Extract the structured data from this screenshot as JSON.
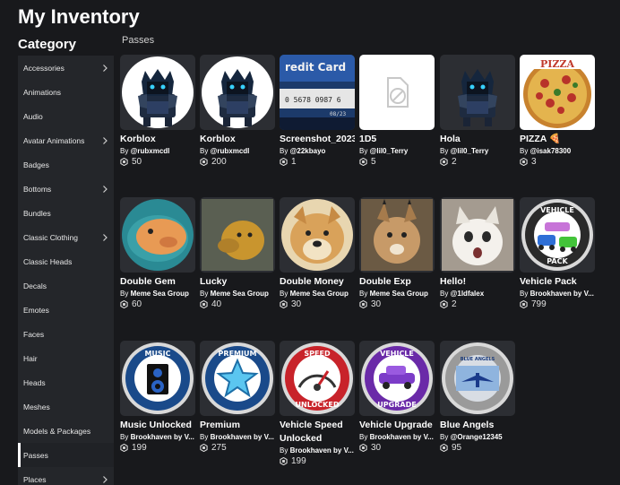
{
  "page": {
    "title": "My Inventory"
  },
  "sidebar": {
    "title": "Category",
    "items": [
      {
        "label": "Accessories",
        "chevron": true
      },
      {
        "label": "Animations",
        "chevron": false
      },
      {
        "label": "Audio",
        "chevron": false
      },
      {
        "label": "Avatar Animations",
        "chevron": true
      },
      {
        "label": "Badges",
        "chevron": false
      },
      {
        "label": "Bottoms",
        "chevron": true
      },
      {
        "label": "Bundles",
        "chevron": false
      },
      {
        "label": "Classic Clothing",
        "chevron": true
      },
      {
        "label": "Classic Heads",
        "chevron": false
      },
      {
        "label": "Decals",
        "chevron": false
      },
      {
        "label": "Emotes",
        "chevron": false
      },
      {
        "label": "Faces",
        "chevron": false
      },
      {
        "label": "Hair",
        "chevron": false
      },
      {
        "label": "Heads",
        "chevron": false
      },
      {
        "label": "Meshes",
        "chevron": false
      },
      {
        "label": "Models & Packages",
        "chevron": false
      },
      {
        "label": "Passes",
        "chevron": false,
        "active": true
      },
      {
        "label": "Places",
        "chevron": true
      }
    ]
  },
  "main": {
    "section_title": "Passes",
    "items": [
      {
        "name": "Korblox",
        "by": "By",
        "creator": "@rubxmcdl",
        "count": "50",
        "icon": "korblox-avatar-icon"
      },
      {
        "name": "Korblox",
        "by": "By",
        "creator": "@rubxmcdl",
        "count": "200",
        "icon": "korblox-avatar-icon"
      },
      {
        "name": "Screenshot_2023",
        "by": "By",
        "creator": "@22kbayo",
        "count": "1",
        "icon": "credit-card-photo",
        "thumb_text": "redit Card",
        "thumb_digits": "0 5678 0987 6",
        "thumb_date": "08/23"
      },
      {
        "name": "1D5",
        "by": "By",
        "creator": "@lil0_Terry",
        "count": "5",
        "icon": "broken-image-icon"
      },
      {
        "name": "Hola",
        "by": "By",
        "creator": "@lil0_Terry",
        "count": "2",
        "icon": "korblox-avatar-icon"
      },
      {
        "name": "PIZZA 🍕",
        "by": "By",
        "creator": "@isak78300",
        "count": "3",
        "icon": "pizza-photo"
      },
      {
        "name": "Double Gem",
        "by": "By",
        "creator": "Meme Sea Group",
        "count": "60",
        "icon": "fish-photo"
      },
      {
        "name": "Lucky",
        "by": "By",
        "creator": "Meme Sea Group",
        "count": "40",
        "icon": "cheems-dog-photo"
      },
      {
        "name": "Double Money",
        "by": "By",
        "creator": "Meme Sea Group",
        "count": "30",
        "icon": "doge-photo"
      },
      {
        "name": "Double Exp",
        "by": "By",
        "creator": "Meme Sea Group",
        "count": "30",
        "icon": "floppa-photo"
      },
      {
        "name": "Hello!",
        "by": "By",
        "creator": "@1ldfalex",
        "count": "2",
        "icon": "cat-photo"
      },
      {
        "name": "Vehicle Pack",
        "by": "By",
        "creator": "Brookhaven by V...",
        "count": "799",
        "icon": "vehicle-pack-badge",
        "badge_top": "VEHICLE",
        "badge_bottom": "PACK"
      },
      {
        "name": "Music Unlocked",
        "by": "By",
        "creator": "Brookhaven by V...",
        "count": "199",
        "icon": "music-badge",
        "badge_top": "MUSIC"
      },
      {
        "name": "Premium",
        "by": "By",
        "creator": "Brookhaven by V...",
        "count": "275",
        "icon": "premium-badge",
        "badge_top": "PREMIUM"
      },
      {
        "name": "Vehicle Speed Unlocked",
        "by": "By",
        "creator": "Brookhaven by V...",
        "count": "199",
        "icon": "speed-badge",
        "badge_top": "SPEED",
        "badge_bottom": "UNLOCKED"
      },
      {
        "name": "Vehicle Upgrade",
        "by": "By",
        "creator": "Brookhaven by V...",
        "count": "30",
        "icon": "vehicle-upgrade-badge",
        "badge_top": "VEHICLE",
        "badge_bottom": "UPGRADE"
      },
      {
        "name": "Blue Angels",
        "by": "By",
        "creator": "@Orange12345",
        "count": "95",
        "icon": "blue-angels-badge",
        "badge_top": "BLUE ANGELS"
      }
    ]
  },
  "colors": {
    "background": "#18191c",
    "sidebar": "#24262a",
    "thumb": "#2c2e33",
    "text": "#ffffff"
  }
}
